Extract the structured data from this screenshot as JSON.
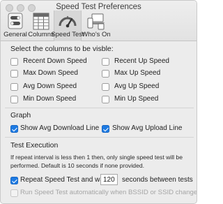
{
  "window": {
    "title": "Speed Test Preferences"
  },
  "toolbar": {
    "items": [
      {
        "label": "General",
        "icon": "gear-switch-icon"
      },
      {
        "label": "Columns",
        "icon": "grid-icon"
      },
      {
        "label": "Speed Test",
        "icon": "speedometer-icon",
        "active": true
      },
      {
        "label": "Who's On",
        "icon": "devices-icon"
      }
    ]
  },
  "columns": {
    "heading": "Select the columns to be visble:",
    "options": {
      "recent_down": {
        "label": "Recent Down Speed",
        "checked": false
      },
      "recent_up": {
        "label": "Recent Up Speed",
        "checked": false
      },
      "max_down": {
        "label": "Max Down Speed",
        "checked": false
      },
      "max_up": {
        "label": "Max Up Speed",
        "checked": false
      },
      "avg_down": {
        "label": "Avg Down Speed",
        "checked": false
      },
      "avg_up": {
        "label": "Avg Up Speed",
        "checked": false
      },
      "min_down": {
        "label": "Min Down Speed",
        "checked": false
      },
      "min_up": {
        "label": "Min Up Speed",
        "checked": false
      }
    }
  },
  "graph": {
    "heading": "Graph",
    "show_avg_download": {
      "label": "Show Avg Download Line",
      "checked": true
    },
    "show_avg_upload": {
      "label": "Show Avg Upload Line",
      "checked": true
    }
  },
  "test_execution": {
    "heading": "Test Execution",
    "note": "If repeat interval is less then 1 then, only single speed test will be performed. Default is 10 seconds if none provided.",
    "repeat": {
      "label": "Repeat Speed Test and wait",
      "checked": true,
      "value": "120",
      "suffix": "seconds between tests"
    },
    "auto_run": {
      "label": "Run Speed Test automatically when BSSID or SSID changes",
      "checked": false,
      "disabled": true
    }
  },
  "colors": {
    "accent": "#1e7be3"
  }
}
